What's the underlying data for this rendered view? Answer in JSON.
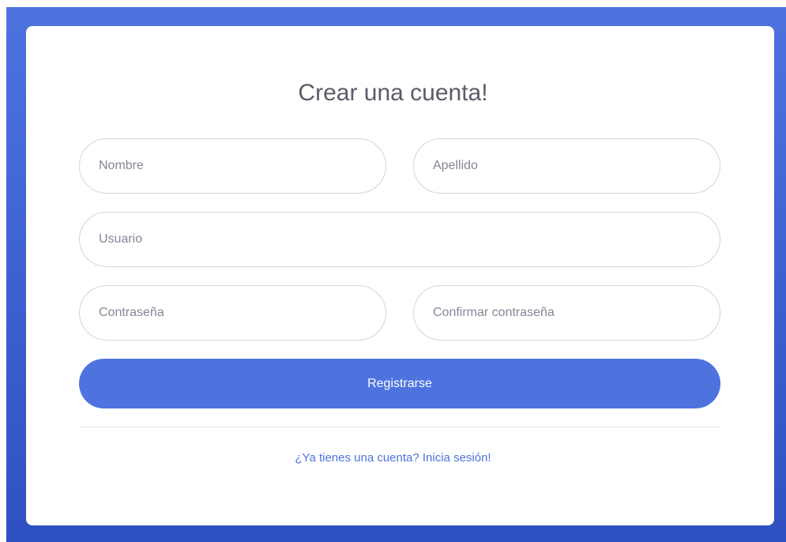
{
  "form": {
    "title": "Crear una cuenta!",
    "fields": {
      "first_name": {
        "placeholder": "Nombre",
        "value": ""
      },
      "last_name": {
        "placeholder": "Apellido",
        "value": ""
      },
      "username": {
        "placeholder": "Usuario",
        "value": ""
      },
      "password": {
        "placeholder": "Contraseña",
        "value": ""
      },
      "confirm_password": {
        "placeholder": "Confirmar contraseña",
        "value": ""
      }
    },
    "submit_label": "Registrarse",
    "login_link_text": "¿Ya tienes una cuenta? Inicia sesión!"
  },
  "colors": {
    "accent": "#4e73df",
    "background_gradient_start": "#4e73df",
    "background_gradient_end": "#2e50c0",
    "title_text": "#5a5c69",
    "field_border": "#d1d3e2"
  }
}
